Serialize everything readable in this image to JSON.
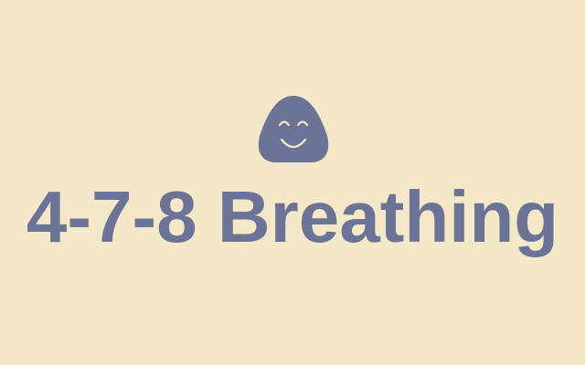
{
  "app": {
    "title": "4-7-8 Breathing",
    "mascot_icon": "smiling-blob-icon"
  },
  "colors": {
    "background": "#f5e8c8",
    "accent": "#6b7396",
    "face_lines": "#f5e8c8"
  }
}
